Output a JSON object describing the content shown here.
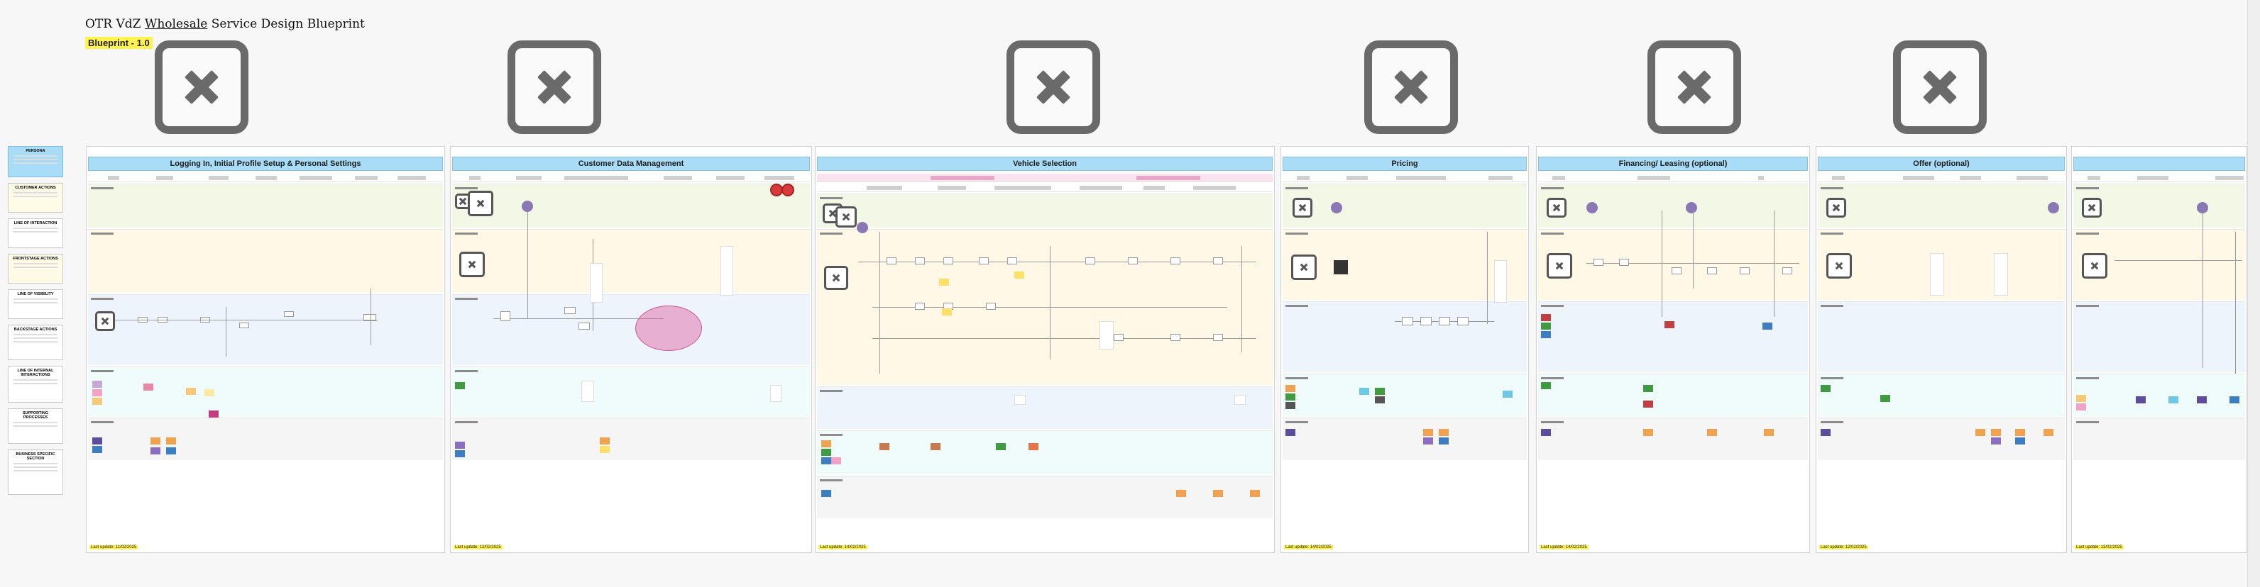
{
  "title": {
    "prefix": "OTR VdZ",
    "underlined": "Wholesale",
    "suffix": "Service Design Blueprint"
  },
  "version": "Blueprint - 1.0",
  "legend": [
    "PERSONA",
    "CUSTOMER ACTIONS",
    "LINE OF INTERACTION",
    "FRONTSTAGE ACTIONS",
    "LINE OF VISIBILITY",
    "BACKSTAGE ACTIONS",
    "LINE OF INTERNAL INTERACTIONS",
    "SUPPORTING PROCESSES",
    "BUSINESS SPECIFIC SECTION"
  ],
  "frames": [
    {
      "title": "Logging In, Initial Profile Setup & Personal Settings",
      "update": "Last update: 11/02/2025"
    },
    {
      "title": "Customer Data Management",
      "update": "Last update: 12/02/2025"
    },
    {
      "title": "Vehicle Selection",
      "update": "Last update: 14/02/2025"
    },
    {
      "title": "Pricing",
      "update": "Last update: 14/02/2025"
    },
    {
      "title": "Financing/ Leasing (optional)",
      "update": "Last update: 14/02/2025"
    },
    {
      "title": "Offer (optional)",
      "update": "Last update: 12/02/2025"
    },
    {
      "title": "",
      "update": "Last update: 13/02/2025"
    }
  ],
  "colors": {
    "header_blue": "#a9dcf6",
    "customer_lane": "#f3f8e6",
    "frontstage_lane": "#fff8e7",
    "backstage_lane": "#eef4fc",
    "internal_lane": "#effcfb",
    "support_lane": "#f5f5f5",
    "highlight_yellow": "#fff34d",
    "placeholder_gray": "#6a6a6a"
  },
  "icons": [
    "broken-image-icon",
    "close-icon"
  ]
}
